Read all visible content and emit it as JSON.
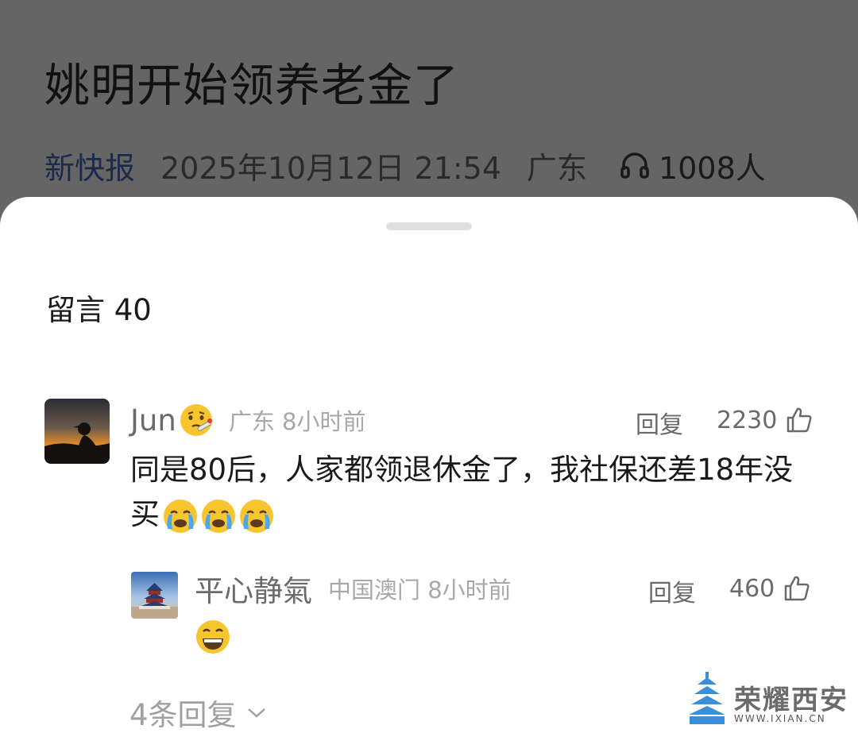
{
  "article": {
    "title": "姚明开始领养老金了",
    "source": "新快报",
    "time": "2025年10月12日 21:54",
    "region": "广东",
    "listeners": "1008人"
  },
  "comments_panel": {
    "header": "留言 40",
    "comment": {
      "author": "Jun",
      "author_emoji": "face-with-thermometer",
      "location_time": "广东 8小时前",
      "reply_label": "回复",
      "likes": "2230",
      "text": "同是80后，人家都领退休金了，我社保还差18年没买",
      "trailing_emojis": [
        "loudly-crying-face",
        "loudly-crying-face",
        "loudly-crying-face"
      ]
    },
    "reply": {
      "author": "平心静氣",
      "location_time": "中国澳门 8小时前",
      "reply_label": "回复",
      "likes": "460",
      "emoji": "grinning-face"
    },
    "more_replies": "4条回复"
  },
  "watermark": {
    "text": "荣耀西安",
    "url": "WWW.IXIAN.CN"
  },
  "colors": {
    "overlay": "#656565",
    "sheet": "#ffffff",
    "emoji_yellow": "#f7c62f"
  }
}
